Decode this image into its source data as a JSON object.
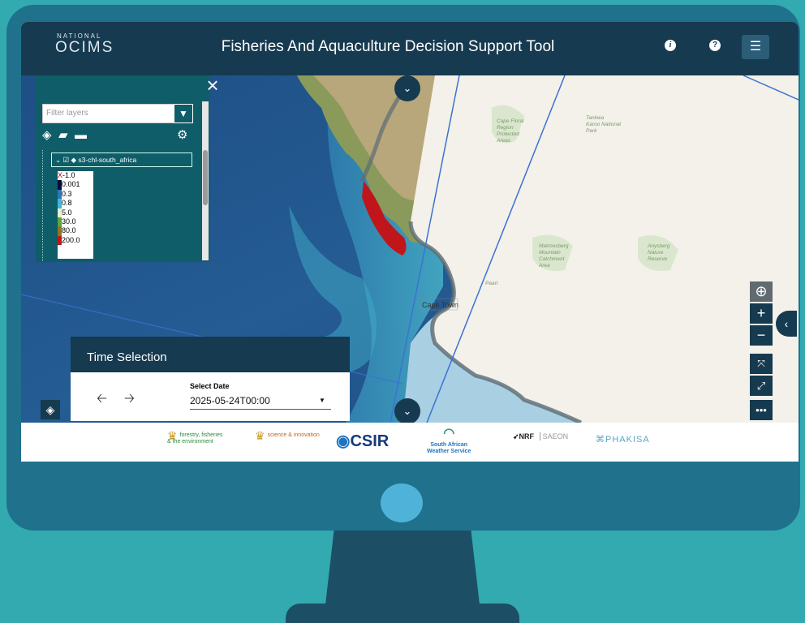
{
  "app": {
    "logo_small": "NATIONAL",
    "logo_large": "OCIMS",
    "title": "Fisheries And Aquaculture Decision Support Tool",
    "info_icon": "info-icon",
    "help_icon": "question-icon",
    "menu_icon": "hamburger-icon"
  },
  "layers_panel": {
    "filter_placeholder": "Filter layers",
    "layer_name": "s3-chl-south_africa",
    "legend": [
      {
        "value": "-1.0",
        "color": "#ffffff"
      },
      {
        "value": "0.001",
        "color": "#0a0a3a"
      },
      {
        "value": "0.3",
        "color": "#2a78b8"
      },
      {
        "value": "0.8",
        "color": "#3fb7d8"
      },
      {
        "value": "5.0",
        "color": "#e8f0c8"
      },
      {
        "value": "30.0",
        "color": "#5aa63c"
      },
      {
        "value": "80.0",
        "color": "#8a7a1c"
      },
      {
        "value": "200.0",
        "color": "#c0161b"
      }
    ]
  },
  "map": {
    "labels": {
      "cape_floral": [
        "Cape Floral",
        "Region",
        "Protected",
        "Areas"
      ],
      "tankwa": [
        "Tankwa",
        "Karoo National",
        "Park"
      ],
      "matroosberg": [
        "Matroosberg",
        "Mountain",
        "Catchment",
        "Area"
      ],
      "anysberg": [
        "Anysberg",
        "Nature",
        "Reserve"
      ],
      "paarl": "Paarl",
      "cape_town": "Cape Town"
    }
  },
  "time_selection": {
    "title": "Time Selection",
    "date_label": "Select Date",
    "date_value": "2025-05-24T00:00"
  },
  "footer_logos": {
    "forestry": [
      "forestry, fisheries",
      "& the environment"
    ],
    "science": "science & innovation",
    "csir": "CSIR",
    "saws": [
      "South African",
      "Weather Service"
    ],
    "nrf": "NRF",
    "saeon": "SAEON",
    "phakisa": "PHAKISA"
  },
  "colors": {
    "header": "#163a4f",
    "panel": "#0e5d68",
    "monitor": "#1f718c",
    "background": "#33a9b0"
  }
}
